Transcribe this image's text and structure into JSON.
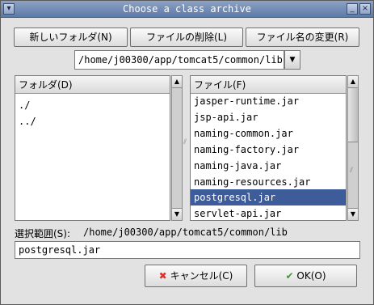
{
  "window": {
    "title": "Choose a class archive",
    "titlebar_icons": [
      "window-menu-icon",
      "minimize-icon",
      "close-icon"
    ]
  },
  "toolbar": {
    "new_folder_label": "新しいフォルダ(N)",
    "delete_file_label": "ファイルの削除(L)",
    "rename_file_label": "ファイル名の変更(R)"
  },
  "path_combo": {
    "value": "/home/j00300/app/tomcat5/common/lib"
  },
  "folders": {
    "header": "フォルダ(D)",
    "items": [
      "./",
      "../"
    ]
  },
  "files": {
    "header": "ファイル(F)",
    "items": [
      "jasper-runtime.jar",
      "jsp-api.jar",
      "naming-common.jar",
      "naming-factory.jar",
      "naming-java.jar",
      "naming-resources.jar",
      "postgresql.jar",
      "servlet-api.jar"
    ],
    "selected": "postgresql.jar"
  },
  "selection": {
    "label": "選択範囲(S):",
    "path": "/home/j00300/app/tomcat5/common/lib",
    "value": "postgresql.jar"
  },
  "buttons": {
    "cancel_label": "キャンセル(C)",
    "ok_label": "OK(O)"
  },
  "colors": {
    "selection": "#3f5c9a",
    "titlebar": "#6f88b3",
    "cancel_icon": "#d93030",
    "ok_icon": "#3c9a2e"
  }
}
